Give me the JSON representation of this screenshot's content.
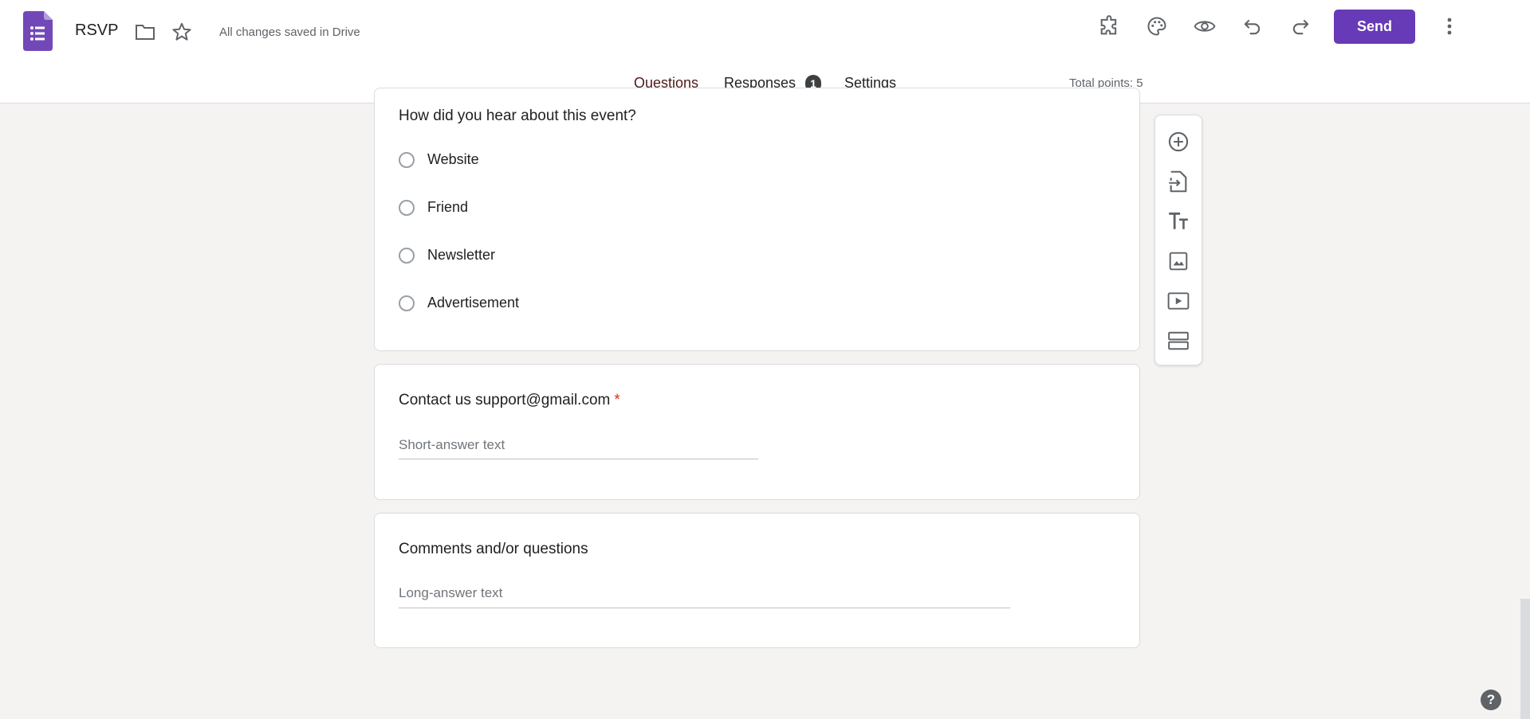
{
  "app": {
    "title": "RSVP",
    "save_status": "All changes saved in Drive",
    "send_label": "Send"
  },
  "tabs": [
    {
      "label": "Questions",
      "active": true
    },
    {
      "label": "Responses",
      "badge": "1"
    },
    {
      "label": "Settings"
    }
  ],
  "total_points": "Total points: 5",
  "colors": {
    "brand": "#673ab7",
    "tab_accent": "#6b1f1f",
    "required": "#d93025",
    "background": "#f4f3f1"
  },
  "questions": [
    {
      "title": "How did you hear about this event?",
      "type": "multiple-choice",
      "options": [
        "Website",
        "Friend",
        "Newsletter",
        "Advertisement"
      ]
    },
    {
      "title": "Contact us support@gmail.com",
      "required_mark": "*",
      "type": "short-answer",
      "placeholder": "Short-answer text"
    },
    {
      "title": "Comments and/or questions",
      "type": "paragraph",
      "placeholder": "Long-answer text"
    }
  ],
  "icons": {
    "header": [
      "forms-logo-icon",
      "folder-icon",
      "star-icon",
      "addons-puzzle-icon",
      "palette-icon",
      "preview-eye-icon",
      "undo-icon",
      "redo-icon",
      "more-vert-icon"
    ],
    "toolbar": [
      "add-question-icon",
      "import-questions-icon",
      "add-title-icon",
      "add-image-icon",
      "add-video-icon",
      "add-section-icon"
    ],
    "misc": [
      "help-icon"
    ]
  },
  "help_label": "?"
}
